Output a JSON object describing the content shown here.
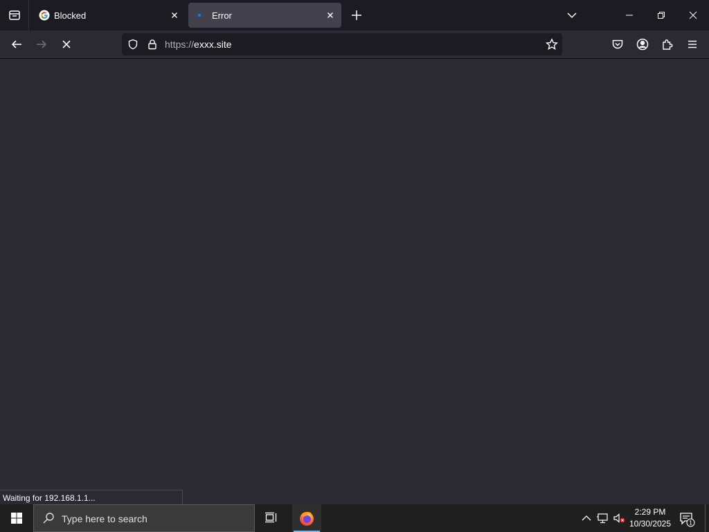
{
  "tabs": [
    {
      "label": "Blocked",
      "icon": "google-icon",
      "active": false
    },
    {
      "label": "Error",
      "icon": "loading-dot-icon",
      "active": true
    }
  ],
  "url": {
    "scheme": "https://",
    "host": "exxx.site"
  },
  "status_text": "Waiting for 192.168.1.1...",
  "taskbar": {
    "search_placeholder": "Type here to search",
    "time": "2:29 PM",
    "date": "10/30/2025",
    "notification_count": "1"
  },
  "colors": {
    "page_bg": "#2b2a33",
    "tabstrip_bg": "#1c1b22",
    "active_tab_bg": "#42414d",
    "taskbar_bg": "#1f1f1f",
    "accent": "#0a84ff"
  }
}
